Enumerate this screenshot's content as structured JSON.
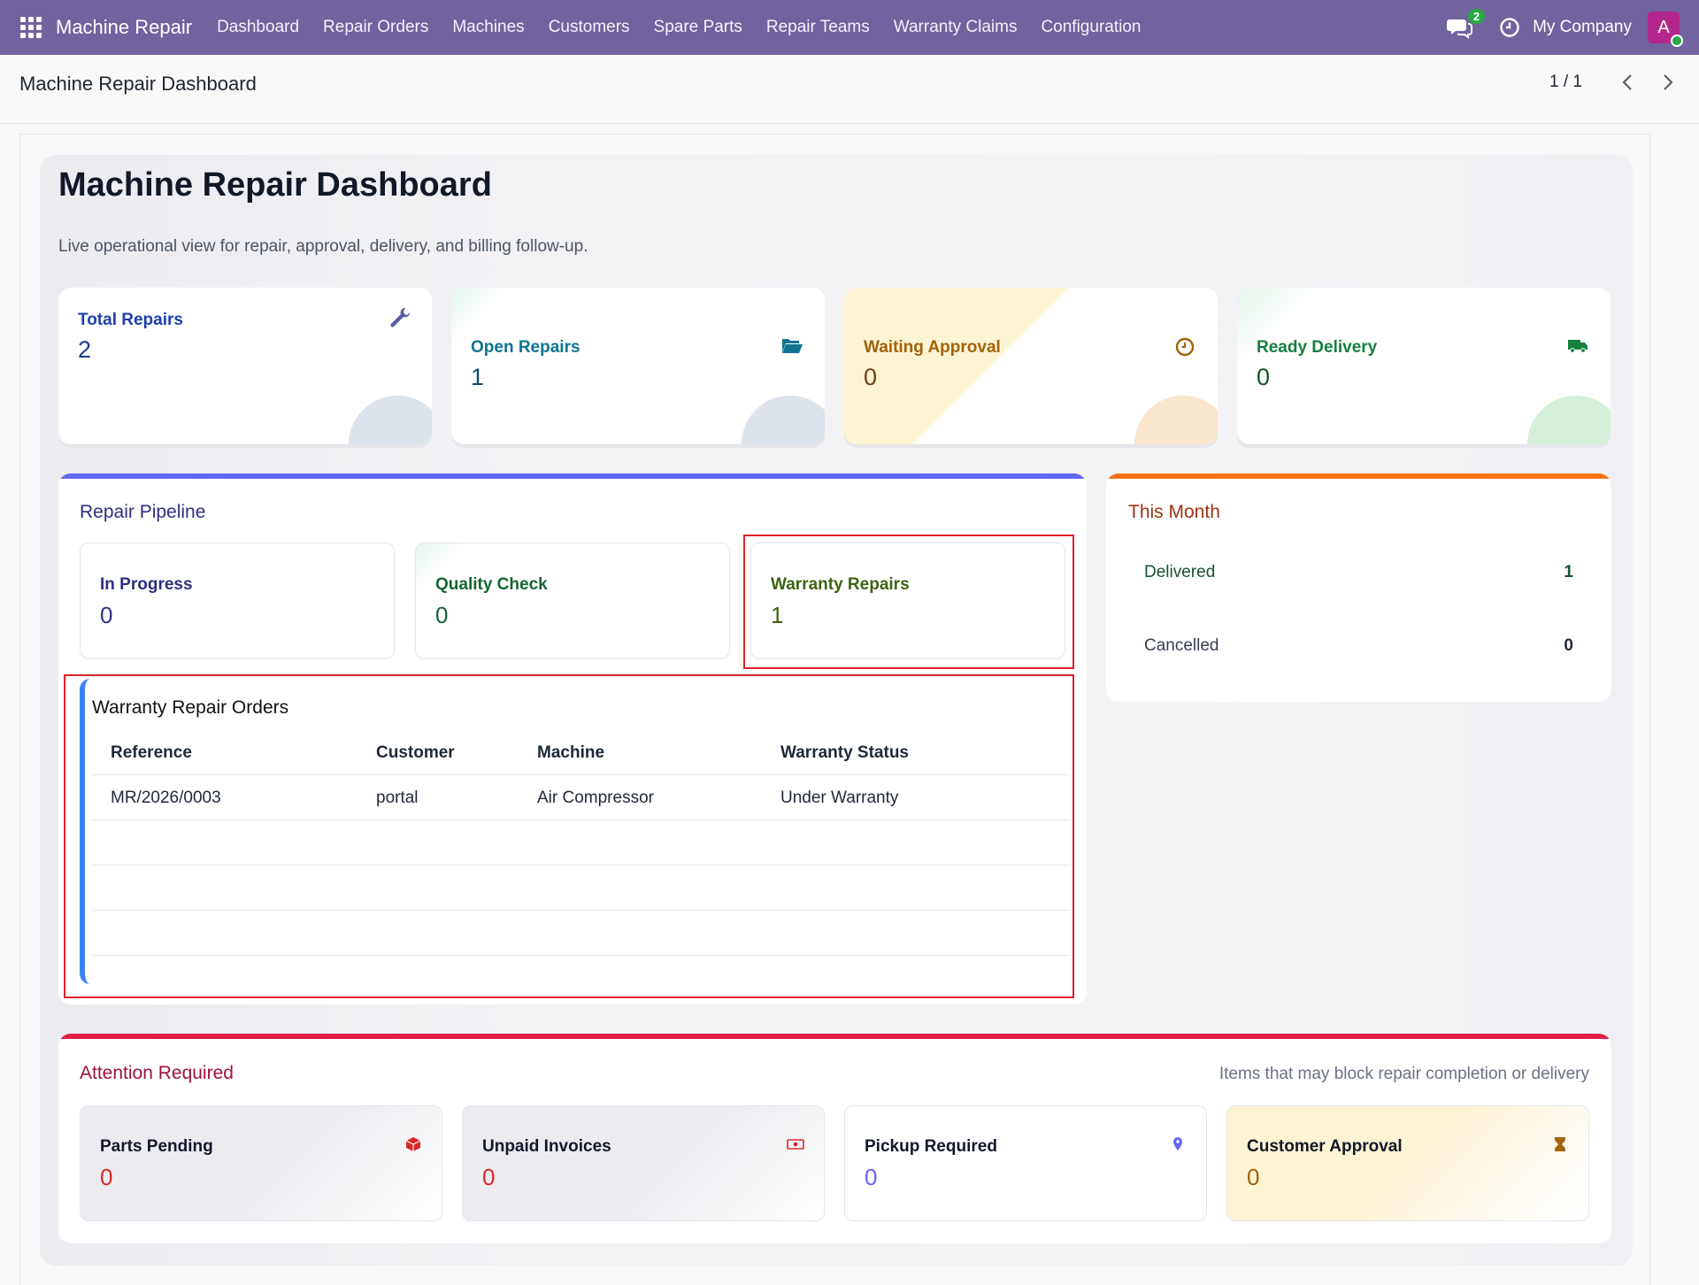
{
  "navbar": {
    "brand": "Machine Repair",
    "items": [
      "Dashboard",
      "Repair Orders",
      "Machines",
      "Customers",
      "Spare Parts",
      "Repair Teams",
      "Warranty Claims",
      "Configuration"
    ],
    "message_count": "2",
    "company": "My Company",
    "avatar_letter": "A"
  },
  "control": {
    "breadcrumb": "Machine Repair Dashboard",
    "pager": "1 / 1"
  },
  "header": {
    "title": "Machine Repair Dashboard",
    "subtitle": "Live operational view for repair, approval, delivery, and billing follow-up."
  },
  "kpis": [
    {
      "label": "Total Repairs",
      "value": "2",
      "icon": "wrench-icon",
      "color": "#1e40af"
    },
    {
      "label": "Open Repairs",
      "value": "1",
      "icon": "folder-open-icon",
      "color": "#0e7490"
    },
    {
      "label": "Waiting Approval",
      "value": "0",
      "icon": "clock-icon",
      "color": "#a16207"
    },
    {
      "label": "Ready Delivery",
      "value": "0",
      "icon": "truck-icon",
      "color": "#15803d"
    }
  ],
  "pipeline": {
    "title": "Repair Pipeline",
    "cards": [
      {
        "label": "In Progress",
        "value": "0",
        "color": "#312e81"
      },
      {
        "label": "Quality Check",
        "value": "0",
        "color": "#166534"
      },
      {
        "label": "Warranty Repairs",
        "value": "1",
        "color": "#3f6212"
      }
    ]
  },
  "warranty_table": {
    "title": "Warranty Repair Orders",
    "columns": [
      "Reference",
      "Customer",
      "Machine",
      "Warranty Status"
    ],
    "rows": [
      [
        "MR/2026/0003",
        "portal",
        "Air Compressor",
        "Under Warranty"
      ]
    ]
  },
  "this_month": {
    "title": "This Month",
    "rows": [
      {
        "label": "Delivered",
        "value": "1"
      },
      {
        "label": "Cancelled",
        "value": "0"
      }
    ]
  },
  "attention": {
    "title": "Attention Required",
    "note": "Items that may block repair completion or delivery",
    "cards": [
      {
        "label": "Parts Pending",
        "value": "0",
        "icon": "cube-icon"
      },
      {
        "label": "Unpaid Invoices",
        "value": "0",
        "icon": "money-icon"
      },
      {
        "label": "Pickup Required",
        "value": "0",
        "icon": "map-pin-icon"
      },
      {
        "label": "Customer Approval",
        "value": "0",
        "icon": "hourglass-icon"
      }
    ]
  },
  "colors": {
    "navbar": "#71639e",
    "pipeline_bar": "#6366f1",
    "month_bar": "#f97316",
    "attention_bar": "#e11d48",
    "highlight": "#e0202a",
    "table_accent": "#3b82f6"
  }
}
